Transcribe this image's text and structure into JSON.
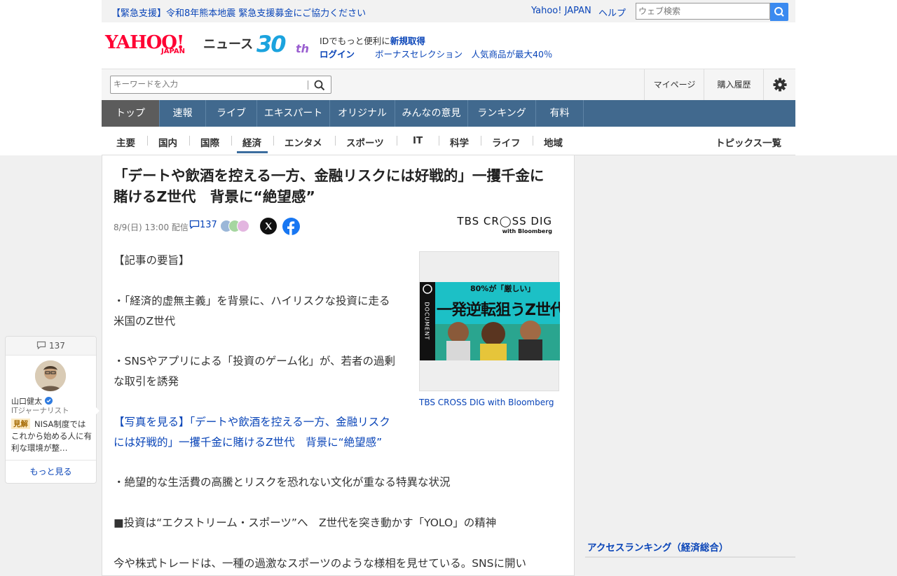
{
  "alert": {
    "text": "【緊急支援】令和8年熊本地震 緊急支援募金にご協力ください"
  },
  "header_links": {
    "yahoo_japan": "Yahoo! JAPAN",
    "help": "ヘルプ"
  },
  "web_search": {
    "placeholder": "ウェブ検索"
  },
  "logo": {
    "main": "YAHOO!",
    "sub": "JAPAN",
    "news": "ニュース",
    "anniv_num": "30",
    "anniv_suffix": "th"
  },
  "account": {
    "id_text_prefix": "IDでもっと便利に",
    "id_text_link": "新規取得",
    "login": "ログイン",
    "promo": "ボーナスセレクション　人気商品が最大40％"
  },
  "search": {
    "placeholder": "キーワードを入力"
  },
  "utility": {
    "mypage": "マイページ",
    "history": "購入履歴"
  },
  "main_nav": [
    {
      "label": "トップ",
      "active": true
    },
    {
      "label": "速報"
    },
    {
      "label": "ライブ"
    },
    {
      "label": "エキスパート"
    },
    {
      "label": "オリジナル"
    },
    {
      "label": "みんなの意見"
    },
    {
      "label": "ランキング"
    },
    {
      "label": "有料"
    }
  ],
  "sub_nav": [
    "主要",
    "国内",
    "国際",
    "経済",
    "エンタメ",
    "スポーツ",
    "IT",
    "科学",
    "ライフ",
    "地域"
  ],
  "sub_nav_active": "経済",
  "topics_link": "トピックス一覧",
  "article": {
    "headline_line1": "「デートや飲酒を控える一方、金融リスクには好戦的」一攫千金に",
    "headline_line2": "賭けるZ世代　背景に“絶望感”",
    "date": "8/9(日) 13:00 配信",
    "comment_count": "137",
    "source_logo_top": "TBS CR◯SS DIG",
    "source_logo_bottom": "with Bloomberg",
    "p1": "【記事の要旨】",
    "p2a": "・「経済的虚無主義」を背景に、ハイリスクな投資に走る",
    "p2b": "米国のZ世代",
    "p3a": "・SNSやアプリによる「投資のゲーム化」が、若者の過剰",
    "p3b": "な取引を誘発",
    "link_a": "【写真を見る】「デートや飲酒を控える一方、金融リスク",
    "link_b": "には好戦的」一攫千金に賭けるZ世代　背景に“絶望感”",
    "p4": "・絶望的な生活費の高騰とリスクを恐れない文化が重なる特異な状況",
    "p5": "■投資は“エクストリーム・スポーツ”へ　Z世代を突き動かす「YOLO」の精神",
    "p6": "今や株式トレードは、一種の過激なスポーツのような様相を見せている。SNSに開い",
    "photo_caption": "TBS CROSS DIG with Bloomberg",
    "thumb_top": "80%が「厳しい」",
    "thumb_main": "一発逆転狙うZ世代",
    "thumb_side": "DOCUMENT"
  },
  "comment_panel": {
    "count": "137",
    "name": "山口健太",
    "role": "ITジャーナリスト",
    "tag": "見解",
    "text": "NISA制度ではこれから始める人に有利な環境が整…",
    "more": "もっと見る"
  },
  "sidebar": {
    "ranking_title": "アクセスランキング（経済総合）"
  },
  "colors": {
    "nav": "#41698e",
    "link": "#0a45b8",
    "logo_red": "#ff0033"
  }
}
